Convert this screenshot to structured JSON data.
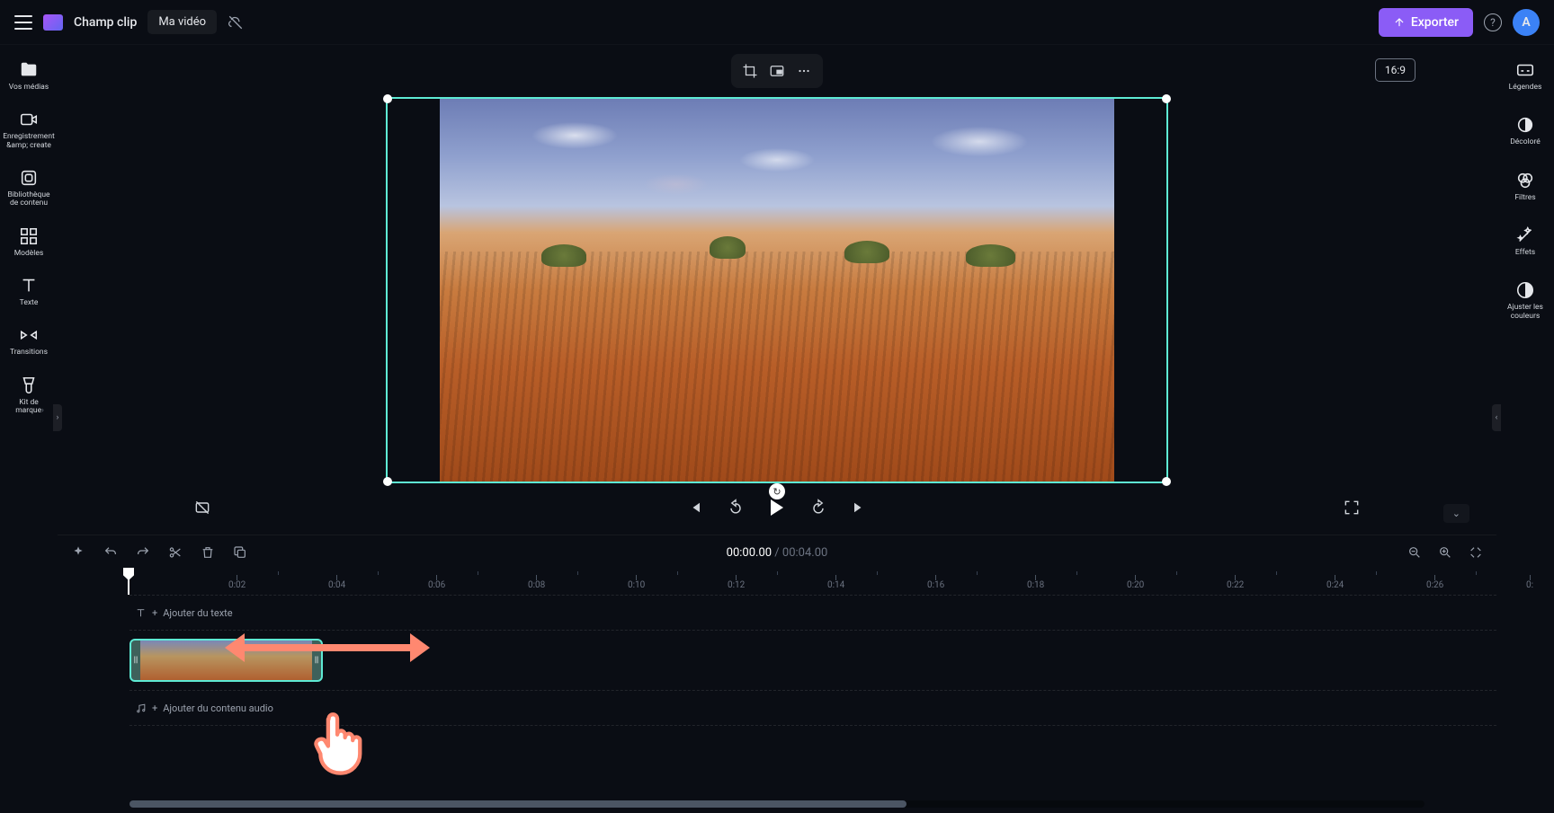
{
  "header": {
    "app_title": "Champ clip",
    "video_name": "Ma vidéo",
    "export_label": "Exporter",
    "avatar_initial": "A"
  },
  "aspect_ratio": "16:9",
  "left_sidebar": {
    "items": [
      {
        "label": "Vos médias"
      },
      {
        "label": "Enregistrement &amp; create"
      },
      {
        "label": "Bibliothèque de contenu"
      },
      {
        "label": "Modèles"
      },
      {
        "label": "Texte"
      },
      {
        "label": "Transitions"
      },
      {
        "label": "Kit de marque"
      }
    ]
  },
  "right_sidebar": {
    "items": [
      {
        "label": "Légendes"
      },
      {
        "label": "Décoloré"
      },
      {
        "label": "Filtres"
      },
      {
        "label": "Effets"
      },
      {
        "label": "Ajuster les couleurs"
      }
    ]
  },
  "time": {
    "current": "00:00.00",
    "separator": " / ",
    "total": "00:04.00"
  },
  "ruler_marks": [
    "0:02",
    "0:04",
    "0:06",
    "0:08",
    "0:10",
    "0:12",
    "0:14",
    "0:16",
    "0:18",
    "0:20",
    "0:22",
    "0:24",
    "0:26",
    "0:"
  ],
  "tracks": {
    "text_label": "Ajouter du texte",
    "audio_label": "Ajouter du contenu audio"
  },
  "colors": {
    "accent": "#8b5cf6",
    "selection": "#5eead4",
    "arrow": "#ff8870"
  }
}
